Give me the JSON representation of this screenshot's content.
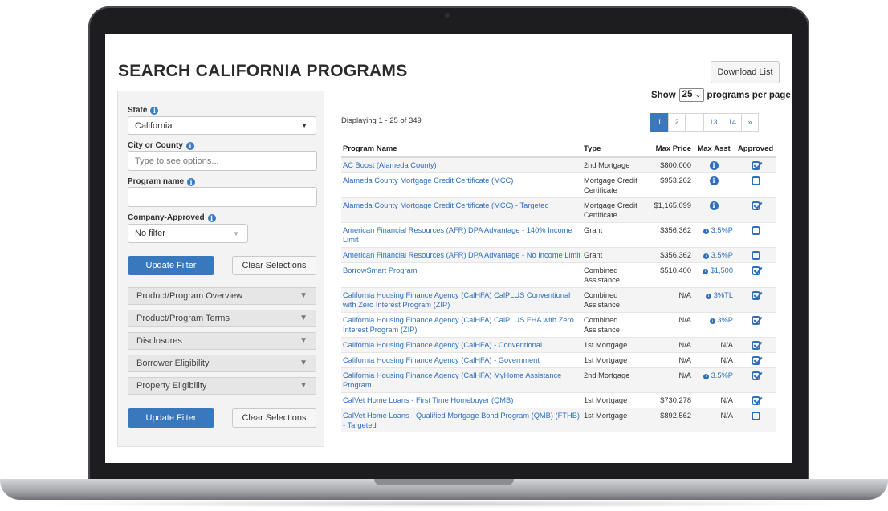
{
  "page": {
    "title": "SEARCH CALIFORNIA PROGRAMS",
    "download_label": "Download List",
    "show_prefix": "Show",
    "show_value": "25",
    "show_suffix": "programs per page"
  },
  "filters": {
    "state": {
      "label": "State",
      "value": "California"
    },
    "city": {
      "label": "City or County",
      "placeholder": "Type to see options..."
    },
    "program_name": {
      "label": "Program name",
      "value": ""
    },
    "company_approved": {
      "label": "Company-Approved",
      "value": "No filter"
    },
    "update_label": "Update Filter",
    "clear_label": "Clear Selections",
    "sections": [
      "Product/Program Overview",
      "Product/Program Terms",
      "Disclosures",
      "Borrower Eligibility",
      "Property Eligibility"
    ]
  },
  "results": {
    "displaying": "Displaying 1 - 25 of 349",
    "pages": [
      "1",
      "2",
      "...",
      "13",
      "14",
      "»"
    ],
    "columns": [
      "Program Name",
      "Type",
      "Max Price",
      "Max Asst",
      "Approved"
    ],
    "rows": [
      {
        "name": "AC Boost (Alameda County)",
        "type": "2nd Mortgage",
        "price": "$800,000",
        "asst": "",
        "approved": true
      },
      {
        "name": "Alameda County Mortgage Credit Certificate (MCC)",
        "type": "Mortgage Credit Certificate",
        "price": "$953,262",
        "asst": "",
        "approved": false
      },
      {
        "name": "Alameda County Mortgage Credit Certificate (MCC) - Targeted",
        "type": "Mortgage Credit Certificate",
        "price": "$1,165,099",
        "asst": "",
        "approved": true
      },
      {
        "name": "American Financial Resources (AFR) DPA Advantage - 140% Income Limit",
        "type": "Grant",
        "price": "$356,362",
        "asst": "3.5%P",
        "approved": false
      },
      {
        "name": "American Financial Resources (AFR) DPA Advantage - No Income Limit",
        "type": "Grant",
        "price": "$356,362",
        "asst": "3.5%P",
        "approved": false
      },
      {
        "name": "BorrowSmart Program",
        "type": "Combined Assistance",
        "price": "$510,400",
        "asst": "$1,500",
        "approved": true
      },
      {
        "name": "California Housing Finance Agency (CalHFA) CalPLUS Conventional with Zero Interest Program (ZIP)",
        "type": "Combined Assistance",
        "price": "N/A",
        "asst": "3%TL",
        "approved": true
      },
      {
        "name": "California Housing Finance Agency (CalHFA) CalPLUS FHA with Zero Interest Program (ZIP)",
        "type": "Combined Assistance",
        "price": "N/A",
        "asst": "3%P",
        "approved": true
      },
      {
        "name": "California Housing Finance Agency (CalHFA) - Conventional",
        "type": "1st Mortgage",
        "price": "N/A",
        "asst": "N/A",
        "approved": true
      },
      {
        "name": "California Housing Finance Agency (CalHFA) - Government",
        "type": "1st Mortgage",
        "price": "N/A",
        "asst": "N/A",
        "approved": true
      },
      {
        "name": "California Housing Finance Agency (CalHFA) MyHome Assistance Program",
        "type": "2nd Mortgage",
        "price": "N/A",
        "asst": "3.5%P",
        "approved": true
      },
      {
        "name": "CalVet Home Loans - First Time Homebuyer (QMB)",
        "type": "1st Mortgage",
        "price": "$730,278",
        "asst": "N/A",
        "approved": true
      },
      {
        "name": "CalVet Home Loans - Qualified Mortgage Bond Program (QMB) (FTHB) - Targeted",
        "type": "1st Mortgage",
        "price": "$892,562",
        "asst": "N/A",
        "approved": false
      }
    ]
  },
  "colors": {
    "accent": "#3a78be",
    "link": "#2f6fba",
    "bezel": "#1d1d1f"
  }
}
